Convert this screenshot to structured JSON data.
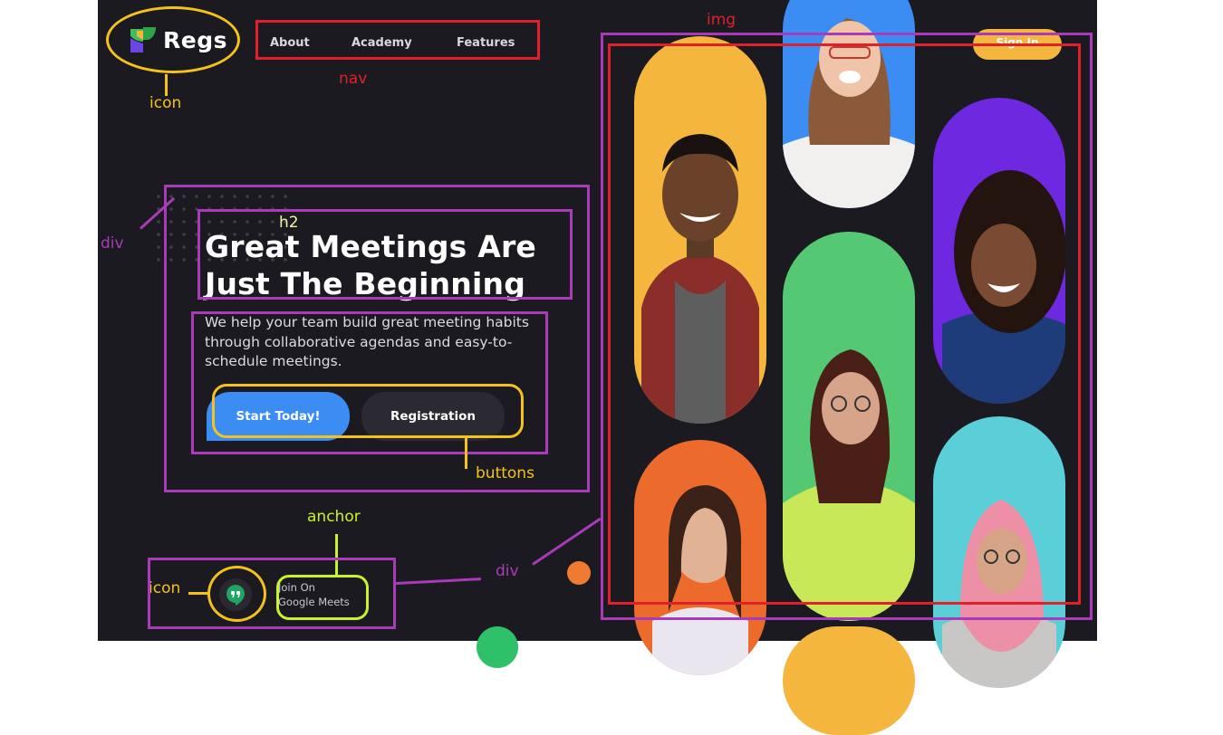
{
  "brand": {
    "name": "Regs"
  },
  "nav": {
    "items": [
      "About",
      "Academy",
      "Features"
    ]
  },
  "header": {
    "signin_label": "Sign In"
  },
  "hero": {
    "title_line1": "Great Meetings Are",
    "title_line2": "Just The Beginning",
    "description": "We help your team build great meeting habits through collaborative agendas and easy-to-schedule meetings.",
    "primary_button": "Start Today!",
    "secondary_button": "Registration"
  },
  "meet": {
    "line1": "Join On",
    "line2": "Google Meets"
  },
  "annotations": {
    "icon_top": "icon",
    "nav": "nav",
    "img": "img",
    "div_left": "div",
    "h2": "h2",
    "buttons": "buttons",
    "anchor": "anchor",
    "icon_bottom": "icon",
    "div_bottom": "div"
  },
  "colors": {
    "background": "#1c1a21",
    "primary": "#3c8df3",
    "secondary_button": "#2b2a32",
    "signin": "#f4b63d",
    "annotation_purple": "#a93ab8",
    "annotation_red": "#e0202a",
    "annotation_yellow": "#f3c21b",
    "annotation_lime": "#c8f22a"
  },
  "icons": {
    "logo": "regs-logo-icon",
    "meet": "google-meet-icon"
  }
}
